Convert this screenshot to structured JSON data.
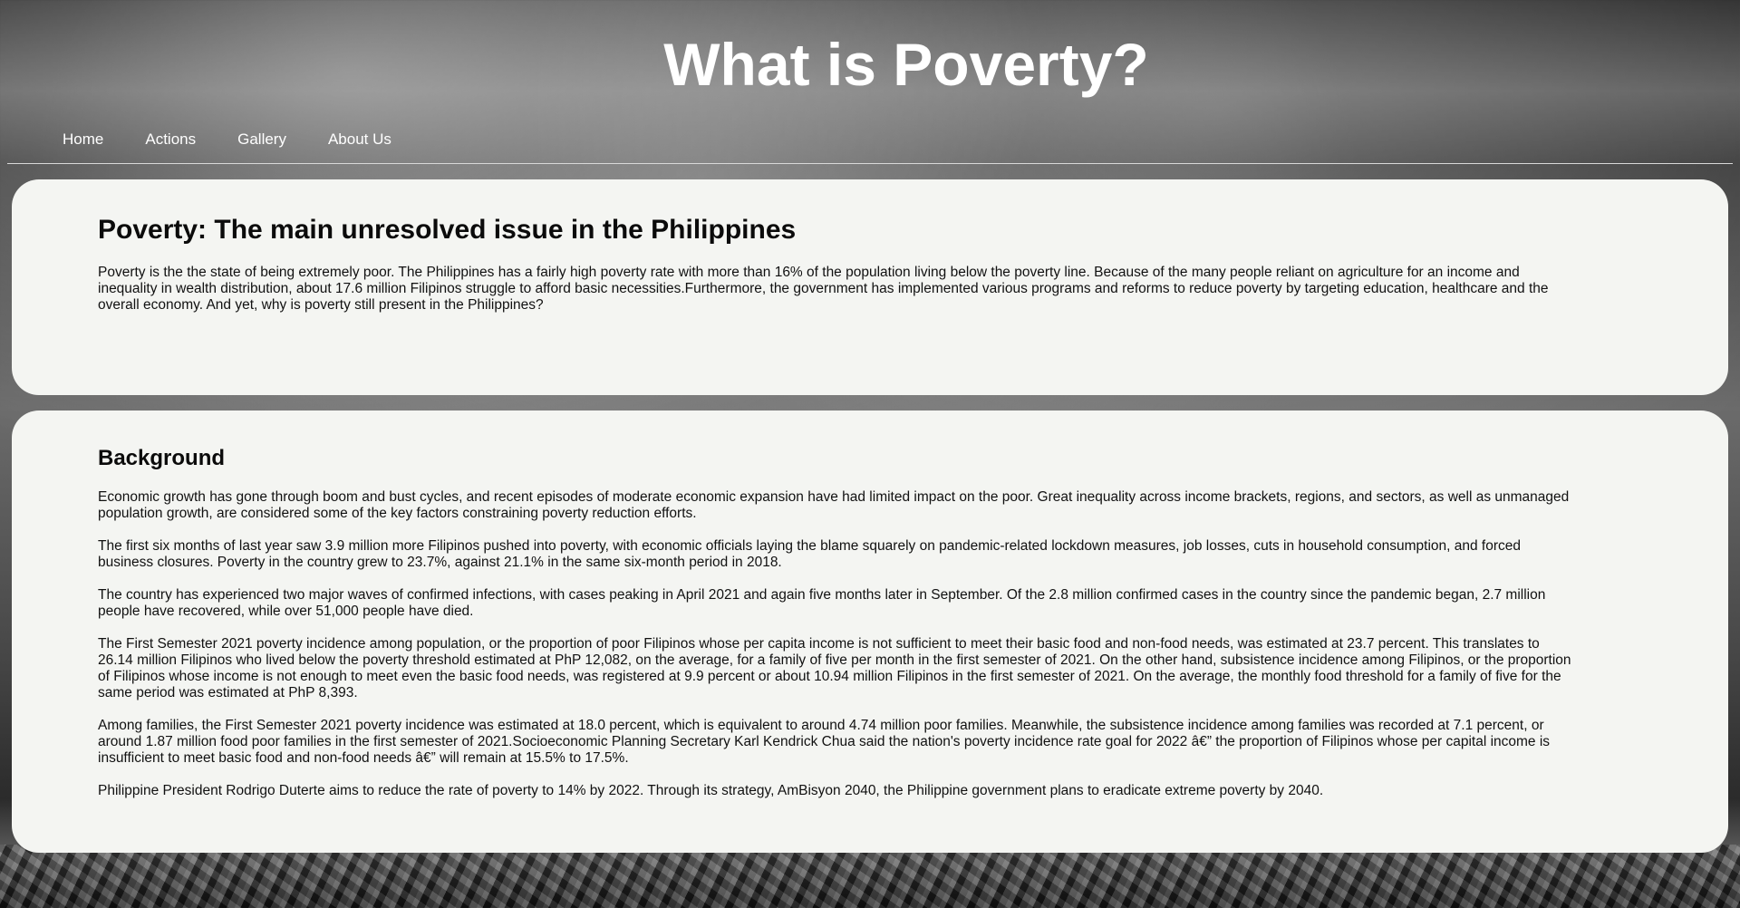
{
  "header": {
    "title": "What is Poverty?"
  },
  "nav": {
    "items": [
      {
        "label": "Home"
      },
      {
        "label": "Actions"
      },
      {
        "label": "Gallery"
      },
      {
        "label": "About Us"
      }
    ]
  },
  "intro": {
    "heading": "Poverty: The main unresolved issue in the Philippines",
    "text": "Poverty is the the state of being extremely poor. The Philippines has a fairly high poverty rate with more than 16% of the population living below the poverty line. Because of the many people reliant on agriculture for an income and inequality in wealth distribution, about 17.6 million Filipinos struggle to afford basic necessities.Furthermore, the government has implemented various programs and reforms to reduce poverty by targeting education, healthcare and the overall economy. And yet, why is poverty still present in the Philippines?"
  },
  "background": {
    "heading": "Background",
    "paragraphs": [
      "Economic growth has gone through boom and bust cycles, and recent episodes of moderate economic expansion have had limited impact on the poor. Great inequality across income brackets, regions, and sectors, as well as unmanaged population growth, are considered some of the key factors constraining poverty reduction efforts.",
      "The first six months of last year saw 3.9 million more Filipinos pushed into poverty, with economic officials laying the blame squarely on pandemic-related lockdown measures, job losses, cuts in household consumption, and forced business closures. Poverty in the country grew to 23.7%, against 21.1% in the same six-month period in 2018.",
      "The country has experienced two major waves of confirmed infections, with cases peaking in April 2021 and again five months later in September. Of the 2.8 million confirmed cases in the country since the pandemic began, 2.7 million people have recovered, while over 51,000 people have died.",
      "The First Semester 2021 poverty incidence among population, or the proportion of poor Filipinos whose per capita income is not sufficient to meet their basic food and non-food needs, was estimated at 23.7 percent. This translates to 26.14 million Filipinos who lived below the poverty threshold estimated at PhP 12,082, on the average, for a family of five per month in the first semester of 2021. On the other hand, subsistence incidence among Filipinos, or the proportion of Filipinos whose income is not enough to meet even the basic food needs, was registered at 9.9 percent or about 10.94 million Filipinos in the first semester of 2021. On the average, the monthly food threshold for a family of five for the same period was estimated at PhP 8,393.",
      "Among families, the First Semester 2021 poverty incidence was estimated at 18.0 percent, which is equivalent to around 4.74 million poor families. Meanwhile, the subsistence incidence among families was recorded at 7.1 percent, or around 1.87 million food poor families in the first semester of 2021.Socioeconomic Planning Secretary Karl Kendrick Chua said the nation's poverty incidence rate goal for 2022 â€” the proportion of Filipinos whose per capital income is insufficient to meet basic food and non-food needs â€” will remain at 15.5% to 17.5%.",
      "Philippine President Rodrigo Duterte aims to reduce the rate of poverty to 14% by 2022. Through its strategy, AmBisyon 2040, the Philippine government plans to eradicate extreme poverty by 2040."
    ]
  }
}
